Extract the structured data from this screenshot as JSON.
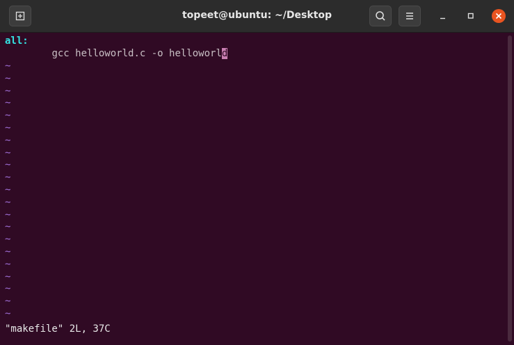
{
  "window": {
    "title": "topeet@ubuntu: ~/Desktop"
  },
  "toolbar": {
    "new_tab_icon": "new-tab-icon",
    "search_icon": "search-icon",
    "menu_icon": "hamburger-menu-icon",
    "minimize_icon": "minimize-icon",
    "maximize_icon": "maximize-icon",
    "close_icon": "close-icon"
  },
  "editor": {
    "line1_target": "all:",
    "line2_indent": "        ",
    "line2_text": "gcc helloworld.c -o helloworl",
    "line2_cursor_char": "d",
    "empty_line_marker": "~",
    "empty_line_count": 21,
    "status_line": "\"makefile\" 2L, 37C"
  },
  "colors": {
    "terminal_bg": "#300a24",
    "titlebar_bg": "#2c2c2c",
    "target_label": "#34e2e2",
    "tilde": "#a06fd8",
    "cursor": "#c97fb2",
    "close_button": "#e95420"
  }
}
